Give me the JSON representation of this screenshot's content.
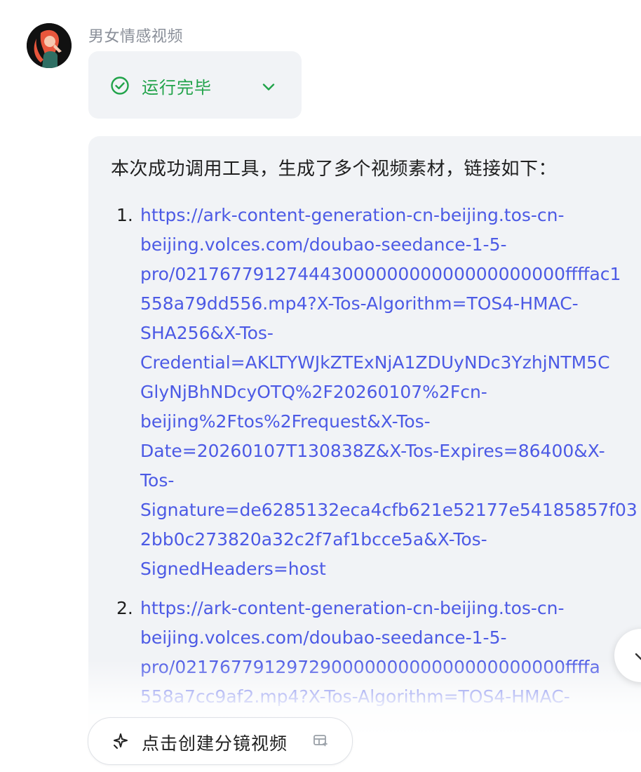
{
  "bot": {
    "name": "男女情感视频",
    "avatar_icon": "avatar-woman-illustration"
  },
  "status": {
    "label": "运行完毕",
    "color": "#21a34a",
    "icon": "check-circle-icon",
    "toggle_icon": "chevron-down-icon"
  },
  "message": {
    "intro": "本次成功调用工具，生成了多个视频素材，链接如下：",
    "links": [
      {
        "number": "1.",
        "lines": [
          "https://ark-content-generation-cn-beijing.tos-cn-",
          "beijing.volces.com/doubao-seedance-1-5-",
          "pro/02176779127444300000000000000000000ffffac1",
          "558a79dd556.mp4?X-Tos-Algorithm=TOS4-HMAC-",
          "SHA256&X-Tos-",
          "Credential=AKLTYWJkZTExNjA1ZDUyNDc3YzhjNTM5C",
          "GlyNjBhNDcyOTQ%2F20260107%2Fcn-",
          "beijing%2Ftos%2Frequest&X-Tos-",
          "Date=20260107T130838Z&X-Tos-Expires=86400&X-",
          "Tos-",
          "Signature=de6285132eca4cfb621e52177e54185857f03",
          "2bb0c273820a32c2f7af1bcce5a&X-Tos-",
          "SignedHeaders=host"
        ]
      },
      {
        "number": "2.",
        "lines": [
          "https://ark-content-generation-cn-beijing.tos-cn-",
          "beijing.volces.com/doubao-seedance-1-5-",
          "pro/02176779129729000000000000000000000ffffa",
          "558a7cc9af2.mp4?X-Tos-Algorithm=TOS4-HMAC-"
        ]
      }
    ],
    "link_color": "#4c5ae5"
  },
  "scroll_button": {
    "icon": "chevron-down-icon"
  },
  "action": {
    "label": "点击创建分镜视频",
    "icon": "sparkle-icon",
    "badge_icon": "layout-icon"
  }
}
